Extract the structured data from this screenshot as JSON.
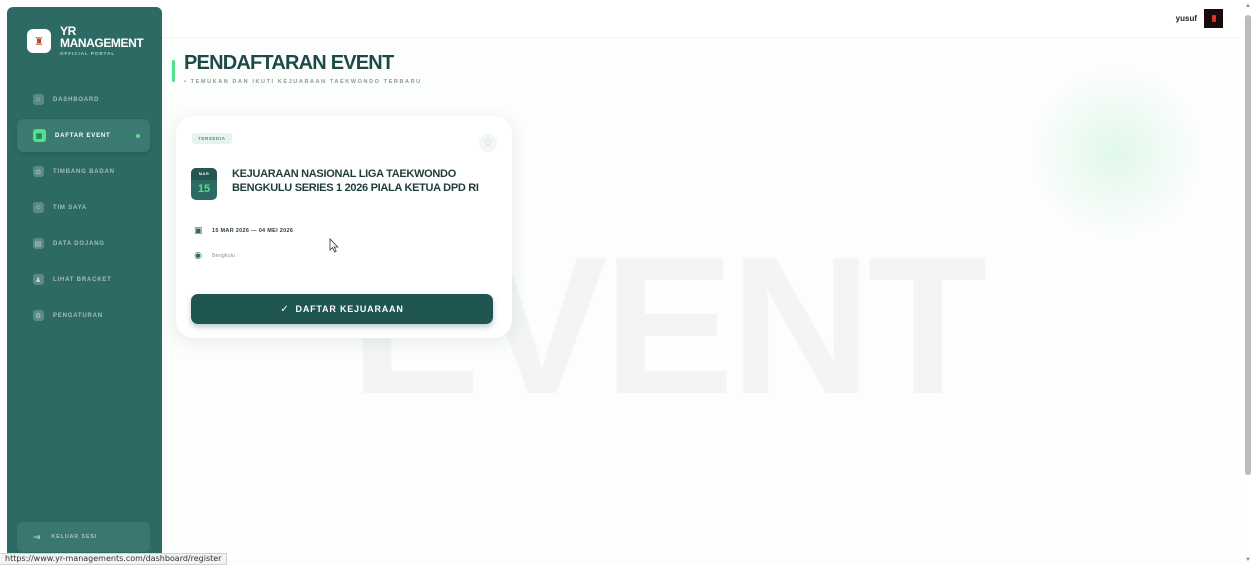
{
  "brand": {
    "title_line1": "YR",
    "title_line2": "MANAGEMENT",
    "subtitle": "OFFICIAL PORTAL",
    "logo_icon": "athlete-logo-icon"
  },
  "sidebar": {
    "items": [
      {
        "label": "DASHBOARD",
        "icon": "home-icon",
        "active": false
      },
      {
        "label": "DAFTAR EVENT",
        "icon": "calendar-icon",
        "active": true
      },
      {
        "label": "TIMBANG BADAN",
        "icon": "scale-icon",
        "active": false
      },
      {
        "label": "TIM SAYA",
        "icon": "team-icon",
        "active": false
      },
      {
        "label": "DATA DOJANG",
        "icon": "building-icon",
        "active": false
      },
      {
        "label": "LIHAT BRACKET",
        "icon": "bracket-icon",
        "active": false
      },
      {
        "label": "PENGATURAN",
        "icon": "gear-icon",
        "active": false
      }
    ],
    "logout_label": "KELUAR SESI"
  },
  "topbar": {
    "username": "yusuf"
  },
  "page": {
    "title": "PENDAFTARAN EVENT",
    "subtitle": "• TEMUKAN DAN IKUTI KEJUARAAN TAEKWONDO TERBARU",
    "watermark": "EVENT"
  },
  "event_card": {
    "status_tag": "TERSEDIA",
    "date_badge_month": "MAR",
    "date_badge_day": "15",
    "title": "KEJUARAAN NASIONAL LIGA TAEKWONDO BENGKULU SERIES 1 2026 PIALA KETUA DPD RI",
    "date_range": "15 MAR 2026 — 04 MEI 2026",
    "location": "Bengkulu",
    "cta_label": "DAFTAR KEJUARAAN"
  },
  "statusbar": {
    "url": "https://www.yr-managements.com/dashboard/register"
  },
  "colors": {
    "sidebar": "#2d6a64",
    "accent": "#52e08a",
    "cta": "#1e5550"
  }
}
